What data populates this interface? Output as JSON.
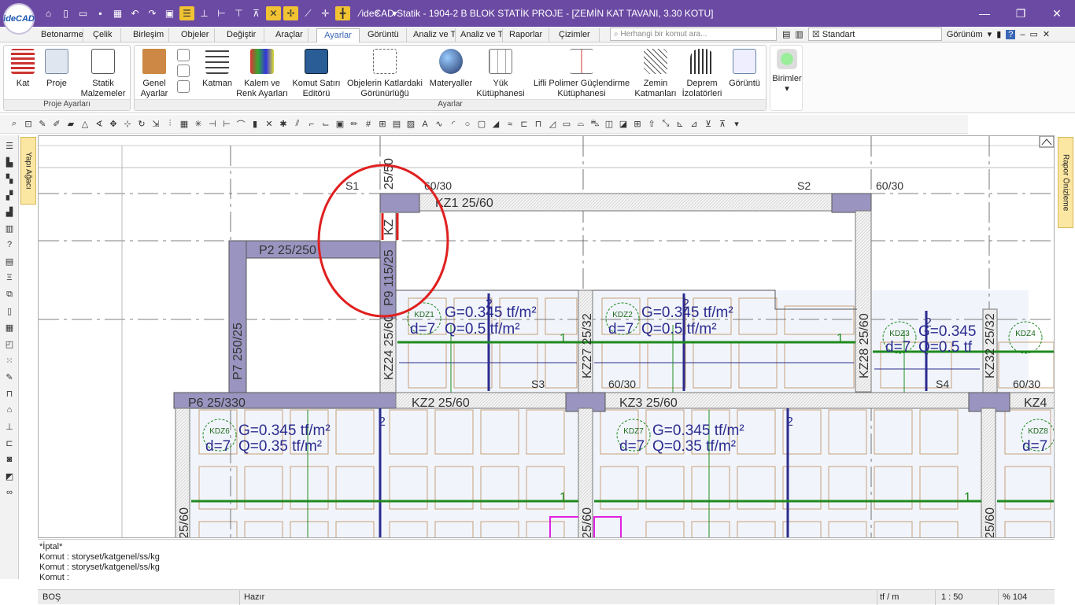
{
  "window": {
    "title": "ideCAD Statik - 1904-2 B BLOK STATİK PROJE - [ZEMİN KAT TAVANI,  3.30 KOTU]",
    "logo": "ideCAD"
  },
  "tabs": [
    "Betonarme",
    "Çelik",
    "Birleşim",
    "Objeler",
    "Değiştir",
    "Araçlar",
    "Ayarlar",
    "Görüntü",
    "Analiz ve T",
    "Analiz ve T",
    "Raporlar",
    "Çizimler"
  ],
  "active_tab": "Ayarlar",
  "search": {
    "placeholder": "Herhangi bir komut ara..."
  },
  "style_select": "Standart",
  "view_menu": "Görünüm",
  "ribbon": {
    "proje_label": "Proje Ayarları",
    "ayarlar_label": "Ayarlar",
    "kat": "Kat",
    "proje": "Proje",
    "statik": "Statik Malzemeler",
    "genel": "Genel Ayarlar",
    "katman": "Katman",
    "kalem": "Kalem ve Renk Ayarları",
    "komut": "Komut Satırı Editörü",
    "objelerin": "Objelerin Katlardaki Görünürlüğü",
    "materyaller": "Materyaller",
    "yuk": "Yük Kütüphanesi",
    "lifli": "Lifli Polimer Güçlendirme Kütüphanesi",
    "zemin": "Zemin Katmanları",
    "deprem": "Deprem İzolatörleri",
    "goruntu": "Görüntü",
    "birimler": "Birimler"
  },
  "side_tabs": {
    "left": "Yapı Ağacı",
    "right": "Rapor Önizleme"
  },
  "drawing": {
    "kz1": "KZ1 25/60",
    "kz2": "KZ2 25/60",
    "kz3": "KZ3 25/60",
    "kz4": "KZ4",
    "p2": "P2 25/250",
    "p6": "P6 25/330",
    "p7": "P7 250/25",
    "p9": "P9 115/25",
    "kz24": "KZ24 25/60",
    "kz27": "KZ27 25/32",
    "kz28": "KZ28 25/60",
    "kz32": "KZ32 25/32",
    "col1": "25/50",
    "col_kz": "KZ",
    "col_bl": "25/60",
    "col_bm": "25/60",
    "col_br": "25/60",
    "s1": "S1",
    "s2": "S2",
    "s3": "S3",
    "s4": "S4",
    "c60a": "60/30",
    "c60b": "60/30",
    "c60c": "60/30",
    "c60d": "60/30",
    "kdz1": "KDZ1",
    "kdz2": "KDZ2",
    "kdz3": "KDZ3",
    "kdz4": "KDZ4",
    "kdz6": "KDZ6",
    "kdz7": "KDZ7",
    "kdz8": "KDZ8",
    "g1": "G=0.345 tf/m²",
    "q1": "Q=0.5 tf/m²",
    "d7": "d=7",
    "g2": "G=0.345 tf/m²",
    "q2": "Q=0.5 tf/m²",
    "g3": "G=0.345",
    "q3": "Q=0.5 tf",
    "g6": "G=0.345 tf/m²",
    "q6": "Q=0.35 tf/m²",
    "g7": "G=0.345 tf/m²",
    "q7": "Q=0.35 tf/m²",
    "n1": "1",
    "n2": "2"
  },
  "command": {
    "line1": "*İptal*",
    "line2": "Komut : storyset/katgenel/ss/kg",
    "line3": "Komut : storyset/katgenel/ss/kg",
    "line4": "Komut :"
  },
  "status": {
    "left": "BOŞ",
    "mid": "Hazır",
    "unit": "tf / m",
    "scale": "1 : 50",
    "zoom": "% 104"
  },
  "colors": {
    "title_bg": "#6b4aa3",
    "beam_fill": "#9a95c0",
    "annotation_red": "#e02020",
    "load_line": "#2b2b8f",
    "green": "#1f8a1f"
  }
}
